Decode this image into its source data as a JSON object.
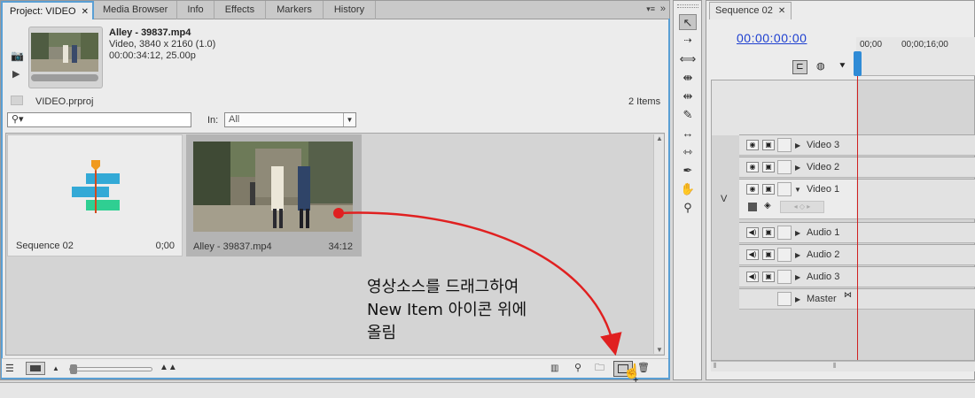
{
  "project_panel": {
    "tabs": [
      {
        "label": "Project: VIDEO",
        "active": true
      },
      {
        "label": "Media Browser"
      },
      {
        "label": "Info"
      },
      {
        "label": "Effects"
      },
      {
        "label": "Markers"
      },
      {
        "label": "History"
      }
    ],
    "preview": {
      "name": "Alley - 39837.mp4",
      "line2": "Video, 3840 x 2160 (1.0)",
      "line3": "00:00:34:12, 25.00p"
    },
    "project_file": "VIDEO.prproj",
    "item_count": "2 Items",
    "search": {
      "icon": "search-icon",
      "value": ""
    },
    "in_filter": {
      "label": "In:",
      "value": "All"
    },
    "items": [
      {
        "name": "Sequence 02",
        "duration": "0;00"
      },
      {
        "name": "Alley - 39837.mp4",
        "duration": "34:12"
      }
    ]
  },
  "annotation": {
    "text": "영상소스를 드래그하여\nNew Item 아이콘 위에\n올림",
    "color": "#e02020"
  },
  "timeline": {
    "tab": "Sequence 02",
    "timecode": "00:00:00:00",
    "ruler": [
      "00;00",
      "00;00;16;00"
    ],
    "track_target": "V",
    "tracks": [
      {
        "name": "Video 3"
      },
      {
        "name": "Video 2"
      },
      {
        "name": "Video 1",
        "expanded": true
      },
      {
        "name": "Audio 1"
      },
      {
        "name": "Audio 2"
      },
      {
        "name": "Audio 3"
      },
      {
        "name": "Master"
      }
    ]
  },
  "colors": {
    "accent": "#5a9fd4",
    "playhead": "#d02020",
    "timecode": "#1d3fd0"
  }
}
